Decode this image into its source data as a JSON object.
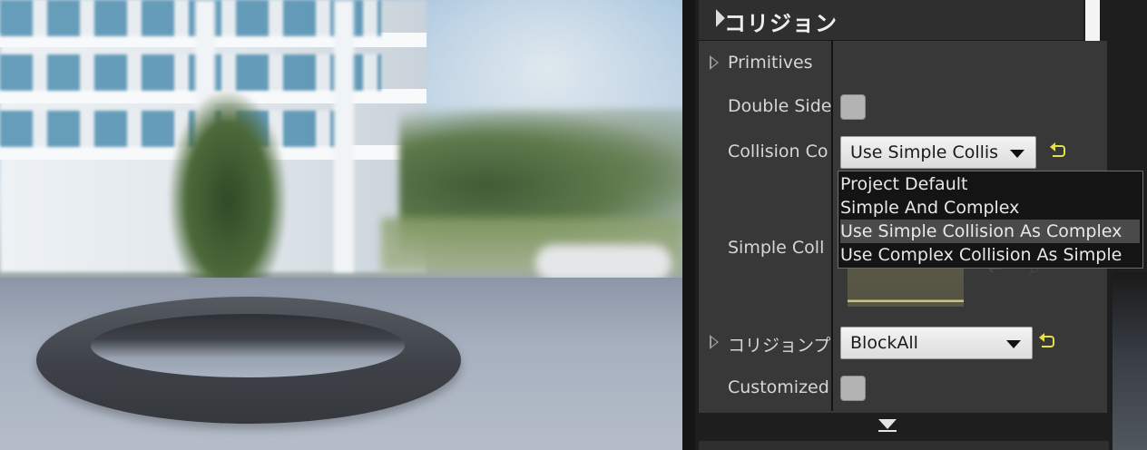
{
  "details": {
    "section_title": "コリジョン",
    "rows": {
      "primitives_label": "Primitives",
      "double_sided_label": "Double Side",
      "collision_complexity_label": "Collision Co",
      "collision_complexity_value": "Use Simple Collis",
      "simple_collision_label": "Simple Coll",
      "collision_presets_label": "コリジョンプ",
      "collision_presets_value": "BlockAll",
      "customized_label": "Customized"
    }
  },
  "dropdown": {
    "options": [
      "Project Default",
      "Simple And Complex",
      "Use Simple Collision As Complex",
      "Use Complex Collision As Simple"
    ],
    "highlighted": "Use Simple Collision As Complex"
  },
  "colors": {
    "panel_bg": "#383838",
    "reset_arrow": "#e5e04a",
    "menu_bg": "#141414"
  },
  "icons": {
    "section_collapse": "triangle-down-icon",
    "expander": "triangle-right-icon",
    "reset": "reset-to-default-icon",
    "more": "chevron-down-icon"
  }
}
